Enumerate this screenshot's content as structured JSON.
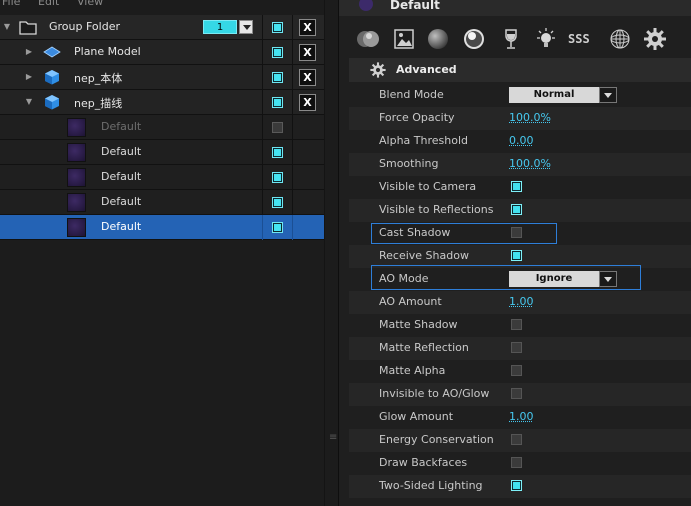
{
  "menu": [
    "File",
    "Edit",
    "View"
  ],
  "tree": {
    "group": {
      "label": "Group Folder",
      "counter": "1",
      "visible": true,
      "close_label": "X"
    },
    "objects": [
      {
        "label": "Plane Model",
        "icon": "plane-model-icon",
        "visible": true,
        "close_label": "X"
      },
      {
        "label": "nep_本体",
        "icon": "cube-model-icon",
        "visible": true,
        "close_label": "X"
      },
      {
        "label": "nep_描线",
        "icon": "cube-model-icon",
        "visible": true,
        "close_label": "X",
        "expanded": true
      }
    ],
    "materials": [
      {
        "label": "Default",
        "visible": false,
        "dimmed": true
      },
      {
        "label": "Default",
        "visible": true
      },
      {
        "label": "Default",
        "visible": true
      },
      {
        "label": "Default",
        "visible": true
      },
      {
        "label": "Default",
        "visible": true,
        "selected": true
      }
    ]
  },
  "inspector": {
    "title": "Default",
    "tabs": [
      "material-sphere-icon",
      "texture-icon",
      "diffuse-sphere-icon",
      "specular-sphere-icon",
      "wine-glass-icon",
      "light-bulb-icon",
      "sss-icon",
      "wireframe-sphere-icon",
      "gear-icon"
    ],
    "tab_text_sss": "SSS",
    "section_title": "Advanced",
    "properties": {
      "blend_mode": {
        "label": "Blend Mode",
        "value": "Normal"
      },
      "force_opacity": {
        "label": "Force Opacity",
        "value": "100.0%"
      },
      "alpha_threshold": {
        "label": "Alpha Threshold",
        "value": "0.00"
      },
      "smoothing": {
        "label": "Smoothing",
        "value": "100.0%"
      },
      "visible_to_camera": {
        "label": "Visible to Camera",
        "checked": true
      },
      "visible_to_reflections": {
        "label": "Visible to Reflections",
        "checked": true
      },
      "cast_shadow": {
        "label": "Cast Shadow",
        "checked": false
      },
      "receive_shadow": {
        "label": "Receive Shadow",
        "checked": true
      },
      "ao_mode": {
        "label": "AO Mode",
        "value": "Ignore"
      },
      "ao_amount": {
        "label": "AO Amount",
        "value": "1.00"
      },
      "matte_shadow": {
        "label": "Matte Shadow",
        "checked": false
      },
      "matte_reflection": {
        "label": "Matte Reflection",
        "checked": false
      },
      "matte_alpha": {
        "label": "Matte Alpha",
        "checked": false
      },
      "invisible_to_ao_glow": {
        "label": "Invisible to AO/Glow",
        "checked": false
      },
      "glow_amount": {
        "label": "Glow Amount",
        "value": "1.00"
      },
      "energy_conservation": {
        "label": "Energy Conservation",
        "checked": false
      },
      "draw_backfaces": {
        "label": "Draw Backfaces",
        "checked": false
      },
      "two_sided_lighting": {
        "label": "Two-Sided Lighting",
        "checked": true
      }
    }
  },
  "colors": {
    "accent": "#45e4f2",
    "selection": "#2463b5",
    "link_value": "#46c8ef",
    "highlight_border": "#2e7ed8"
  }
}
